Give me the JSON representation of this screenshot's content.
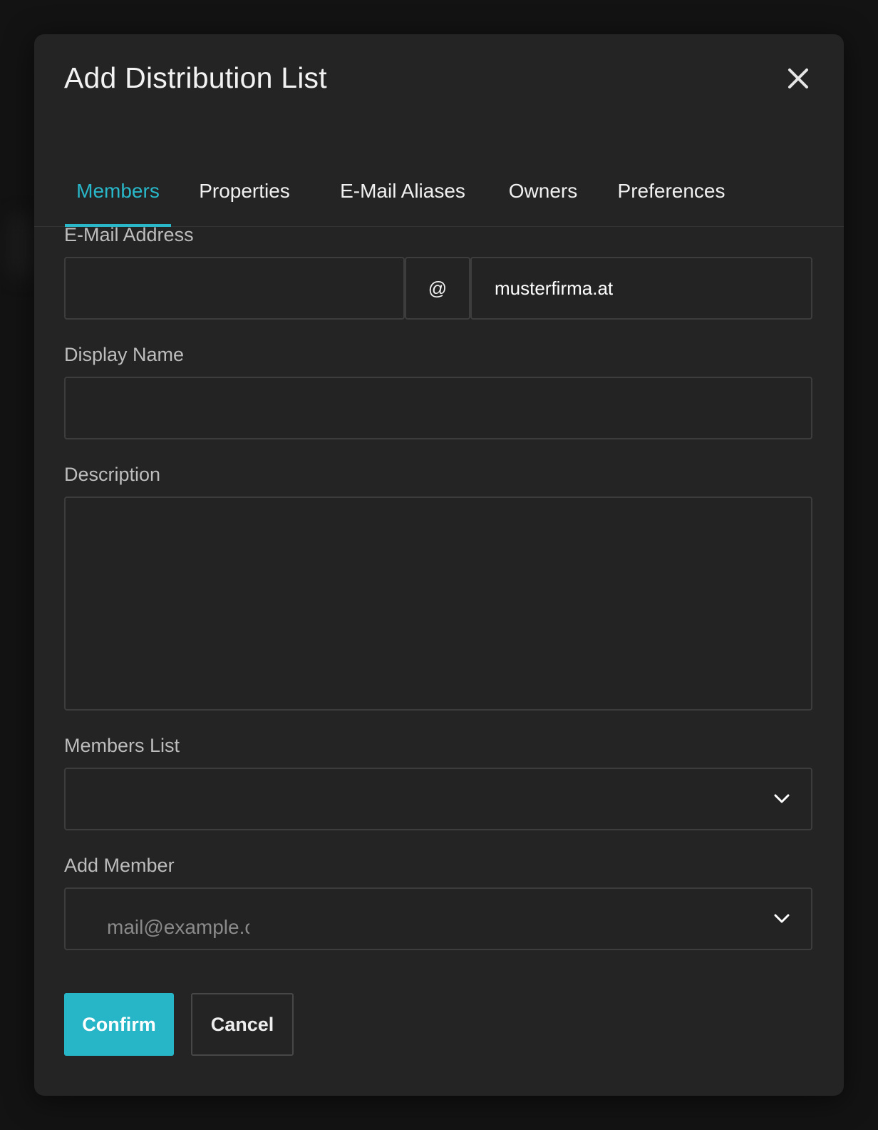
{
  "dialog": {
    "title": "Add Distribution List",
    "close_icon": "close-icon"
  },
  "tabs": [
    {
      "label": "Members",
      "active": true
    },
    {
      "label": "Properties",
      "active": false
    },
    {
      "label": "E-Mail Aliases",
      "active": false
    },
    {
      "label": "Owners",
      "active": false
    },
    {
      "label": "Preferences",
      "active": false
    }
  ],
  "form": {
    "email": {
      "label": "E-Mail Address",
      "local_value": "",
      "at": "@",
      "domain": "musterfirma.at"
    },
    "display_name": {
      "label": "Display Name",
      "value": ""
    },
    "description": {
      "label": "Description",
      "value": ""
    },
    "members_list": {
      "label": "Members List",
      "value": ""
    },
    "add_member": {
      "label": "Add Member",
      "placeholder": "mail@example.c"
    }
  },
  "actions": {
    "confirm_label": "Confirm",
    "cancel_label": "Cancel"
  },
  "colors": {
    "accent": "#29b8c9",
    "dialog_bg": "#242424",
    "page_bg": "#131313"
  }
}
